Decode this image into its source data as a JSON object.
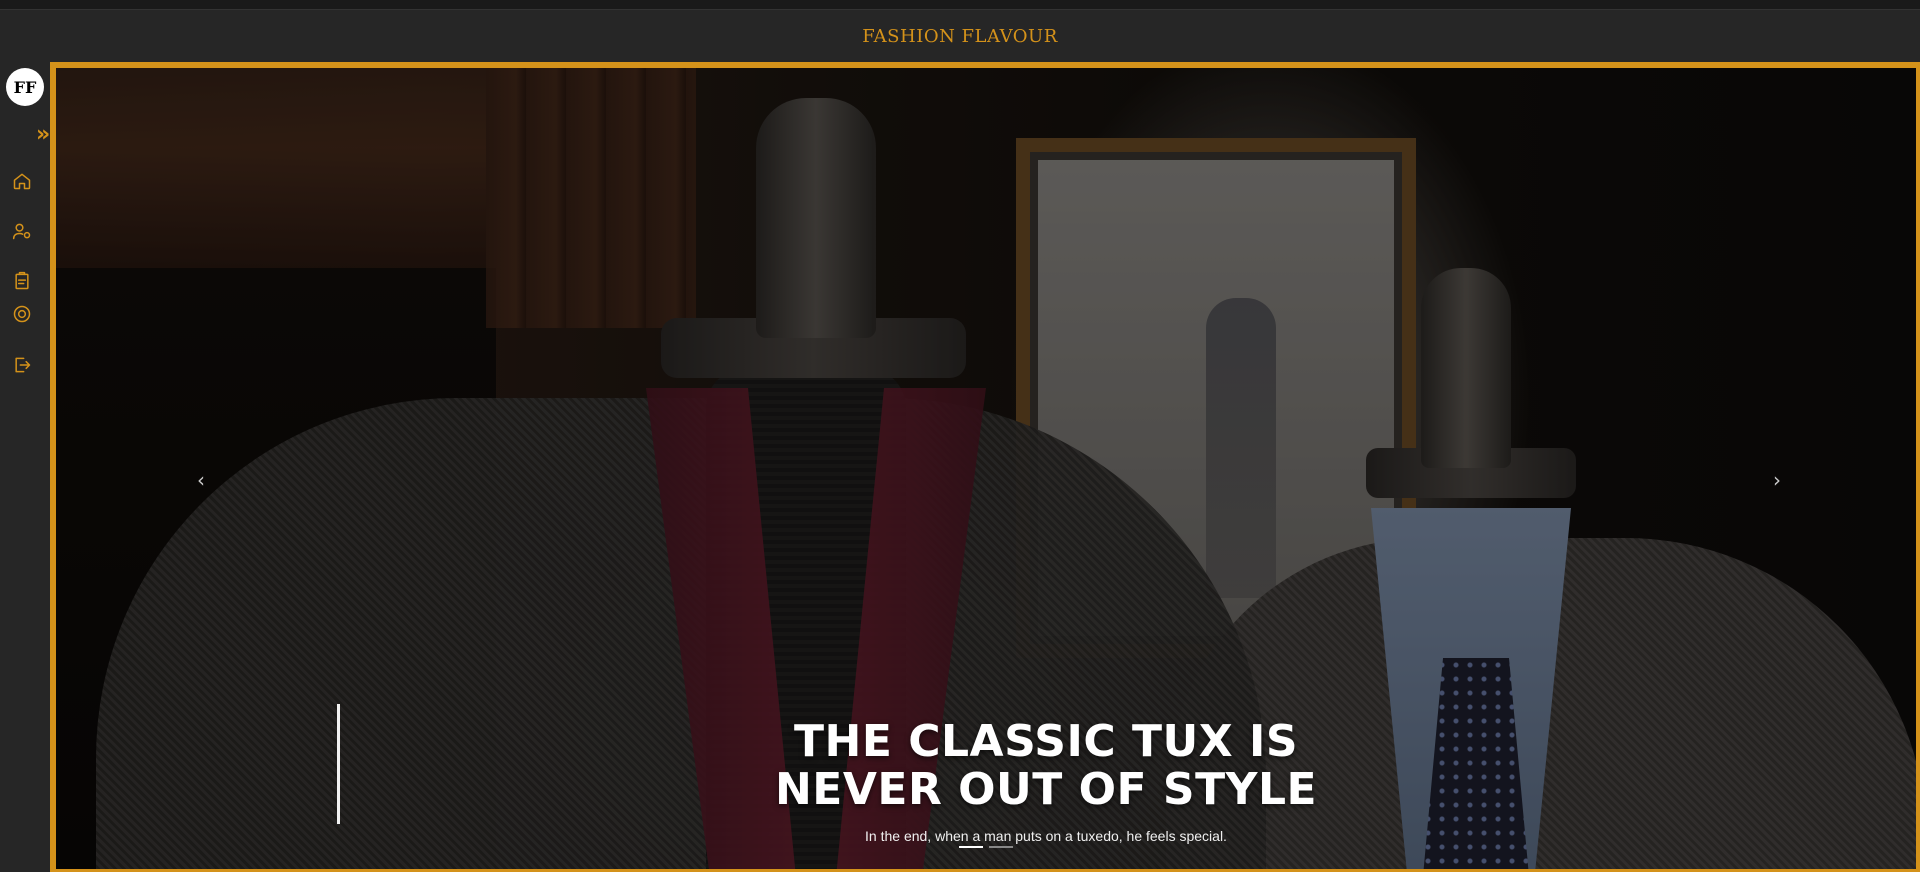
{
  "header": {
    "brand": "FASHION FLAVOUR"
  },
  "sidebar": {
    "logo_text": "FF",
    "expand_glyph": "»",
    "items": [
      {
        "icon": "home-icon",
        "label": ""
      },
      {
        "icon": "users-settings-icon",
        "label": ""
      },
      {
        "icon": "clipboard-icon",
        "label": ""
      },
      {
        "icon": "target-icon",
        "label": ""
      },
      {
        "icon": "logout-icon",
        "label": ""
      }
    ]
  },
  "carousel": {
    "prev_glyph": "‹",
    "next_glyph": "›",
    "title_line1": "THE CLASSIC TUX IS",
    "title_line2": "NEVER OUT OF STYLE",
    "subtitle": "In the end, when a man puts on a tuxedo, he feels special.",
    "slides_total": 2,
    "active_slide": 1
  },
  "colors": {
    "accent": "#d4921a",
    "background": "#262626"
  }
}
